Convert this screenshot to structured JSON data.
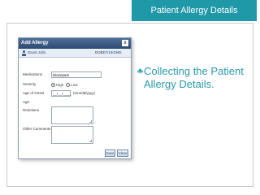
{
  "slide": {
    "title": "Patient Allergy Details",
    "bullet": "Collecting the Patient Allergy Details.",
    "accent_color": "#1f98a8",
    "bullet_icon": "diamond-bullet-icon"
  },
  "dialog": {
    "title": "Add Allergy",
    "close_label": "x",
    "patient_name": "David Jolla",
    "dob_label": "DOB:",
    "dob_value": "07/18/1965",
    "fields": {
      "medications_label": "Medications",
      "medications_value": "Diazepam",
      "severity_label": "Severity",
      "severity_options": [
        "High",
        "Low"
      ],
      "severity_selected": "High",
      "age_of_onset_label": "Age of Onset",
      "age_of_onset_value": "__/__/____",
      "age_of_onset_hint": "(mm/dd/yyyy)",
      "age_label": "Age",
      "reactions_label": "Reactions",
      "other_comments_label": "Other Comments"
    },
    "buttons": {
      "save": "Save",
      "clear": "Clear"
    },
    "icons": [
      "person-icon",
      "close-icon"
    ]
  }
}
